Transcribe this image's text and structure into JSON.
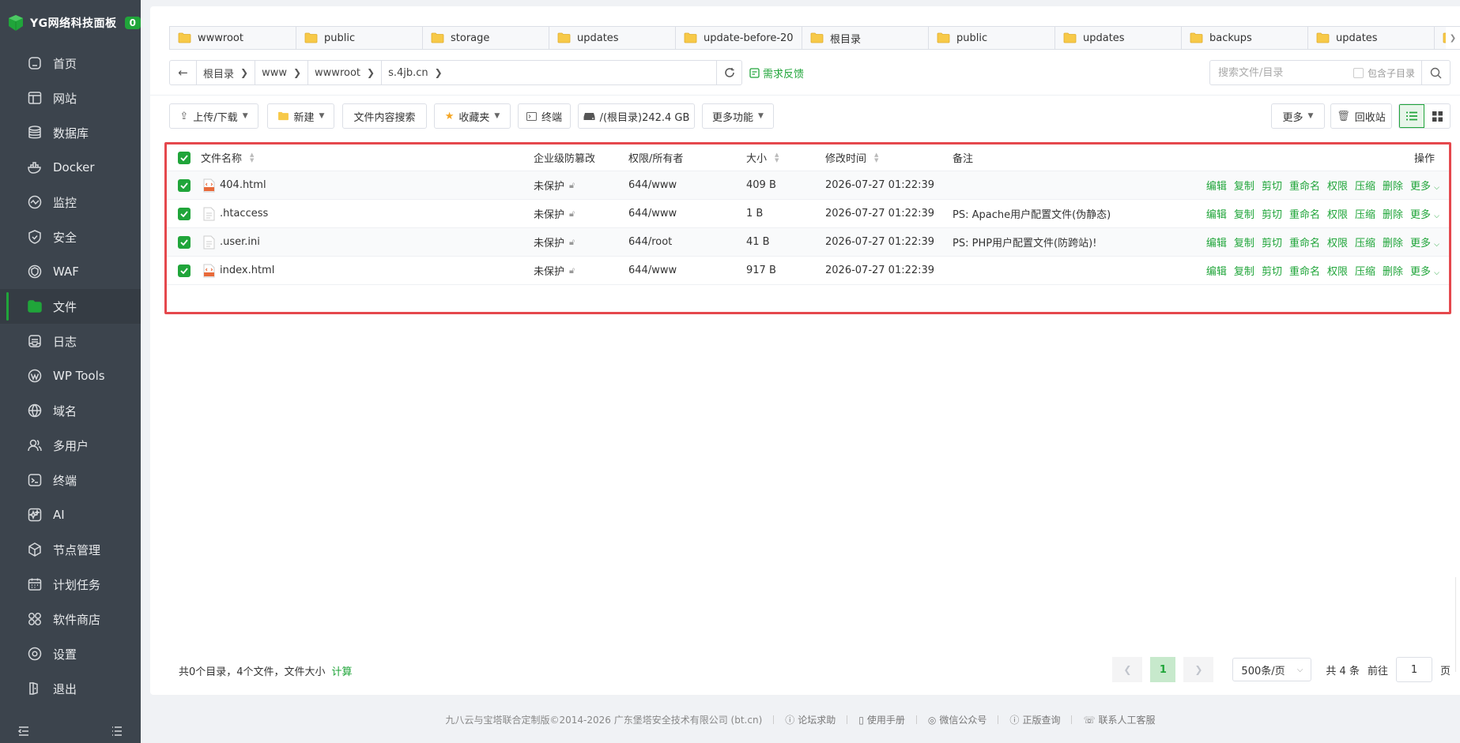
{
  "brand": {
    "title": "YG网络科技面板",
    "badge": "0"
  },
  "sidebar": {
    "items": [
      {
        "label": "首页",
        "icon": "home-icon"
      },
      {
        "label": "网站",
        "icon": "globe-window-icon"
      },
      {
        "label": "数据库",
        "icon": "database-icon"
      },
      {
        "label": "Docker",
        "icon": "docker-icon"
      },
      {
        "label": "监控",
        "icon": "monitor-icon"
      },
      {
        "label": "安全",
        "icon": "shield-icon"
      },
      {
        "label": "WAF",
        "icon": "waf-icon"
      },
      {
        "label": "文件",
        "icon": "folder-icon",
        "active": true
      },
      {
        "label": "日志",
        "icon": "log-icon"
      },
      {
        "label": "WP Tools",
        "icon": "wordpress-icon"
      },
      {
        "label": "域名",
        "icon": "domain-icon"
      },
      {
        "label": "多用户",
        "icon": "users-icon"
      },
      {
        "label": "终端",
        "icon": "terminal-icon"
      },
      {
        "label": "AI",
        "icon": "ai-icon"
      },
      {
        "label": "节点管理",
        "icon": "cube-icon"
      },
      {
        "label": "计划任务",
        "icon": "calendar-icon"
      },
      {
        "label": "软件商店",
        "icon": "apps-icon"
      },
      {
        "label": "设置",
        "icon": "gear-icon"
      },
      {
        "label": "退出",
        "icon": "logout-icon"
      }
    ]
  },
  "tabs": [
    "wwwroot",
    "public",
    "storage",
    "updates",
    "update-before-20",
    "根目录",
    "public",
    "updates",
    "backups",
    "updates"
  ],
  "path": {
    "crumbs": [
      "根目录",
      "www",
      "wwwroot",
      "s.4jb.cn"
    ],
    "feedback": "需求反馈"
  },
  "search": {
    "placeholder": "搜索文件/目录",
    "include_sub": "包含子目录"
  },
  "toolbar": {
    "upload": "上传/下载",
    "new": "新建",
    "content_search": "文件内容搜索",
    "favorites": "收藏夹",
    "terminal": "终端",
    "disk": "/(根目录)242.4 GB",
    "more_functions": "更多功能",
    "more": "更多",
    "recycle": "回收站"
  },
  "table": {
    "headers": {
      "name": "文件名称",
      "protect": "企业级防篡改",
      "perm": "权限/所有者",
      "size": "大小",
      "mtime": "修改时间",
      "note": "备注",
      "ops": "操作"
    },
    "rows": [
      {
        "name": "404.html",
        "type": "html",
        "protect": "未保护",
        "perm": "644/www",
        "size": "409 B",
        "mtime": "2026-07-27 01:22:39",
        "note": ""
      },
      {
        "name": ".htaccess",
        "type": "file",
        "protect": "未保护",
        "perm": "644/www",
        "size": "1 B",
        "mtime": "2026-07-27 01:22:39",
        "note": "PS: Apache用户配置文件(伪静态)"
      },
      {
        "name": ".user.ini",
        "type": "file",
        "protect": "未保护",
        "perm": "644/root",
        "size": "41 B",
        "mtime": "2026-07-27 01:22:39",
        "note": "PS: PHP用户配置文件(防跨站)!"
      },
      {
        "name": "index.html",
        "type": "html",
        "protect": "未保护",
        "perm": "644/www",
        "size": "917 B",
        "mtime": "2026-07-27 01:22:39",
        "note": ""
      }
    ],
    "ops": [
      "编辑",
      "复制",
      "剪切",
      "重命名",
      "权限",
      "压缩",
      "删除",
      "更多"
    ]
  },
  "footer": {
    "summary": "共0个目录，4个文件，文件大小",
    "calc": "计算",
    "page": "1",
    "page_size": "500条/页",
    "total": "共 4 条",
    "goto": "前往",
    "goto_value": "1",
    "page_unit": "页"
  },
  "copyright": {
    "text": "九八云与宝塔联合定制版©2014-2026 广东堡塔安全技术有限公司 (bt.cn)",
    "links": [
      "论坛求助",
      "使用手册",
      "微信公众号",
      "正版查询",
      "联系人工客服"
    ]
  },
  "colors": {
    "accent": "#20a53a",
    "sidebar": "#3c444d",
    "highlight": "#e5484d"
  }
}
